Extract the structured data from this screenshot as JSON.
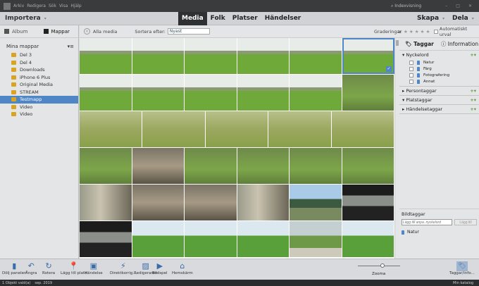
{
  "titlebar": {
    "menu": [
      "Arkiv",
      "Redigera",
      "Sök",
      "Visa",
      "Hjälp"
    ],
    "indexing": "Indexvisning"
  },
  "topbar": {
    "import": "Importera",
    "tabs": [
      "Media",
      "Folk",
      "Platser",
      "Händelser"
    ],
    "active_tab": "Media",
    "create": "Skapa",
    "share": "Dela"
  },
  "left": {
    "tabs": [
      "Album",
      "Mappar"
    ],
    "active_tab": "Mappar",
    "section": "Mina mappar",
    "folders": [
      "Del 3",
      "Del 4",
      "Downloads",
      "iPhone 6 Plus",
      "Original Media",
      "STREAM",
      "Testmapp",
      "Video",
      "Video"
    ],
    "selected": "Testmapp"
  },
  "crumb": {
    "back": "Alla media",
    "sort_label": "Sortera efter:",
    "sort_value": "Nyast",
    "ratings_label": "Graderingar",
    "ratings_op": "≥",
    "stars": "★ ★ ★ ★ ★",
    "auto_label": "Automatiskt urval"
  },
  "grid": {
    "rows": [
      [
        "h",
        "h",
        "h",
        "h",
        "h",
        "h"
      ],
      [
        "h",
        "h",
        "h",
        "h",
        "h",
        "f"
      ],
      [
        "d",
        "d",
        "d",
        "d",
        "d"
      ],
      [
        "f",
        "r",
        "f",
        "f",
        "f",
        "f"
      ],
      [
        "t",
        "r",
        "r",
        "t",
        "m",
        "c"
      ],
      [
        "c",
        "g",
        "g",
        "g",
        "p",
        "g"
      ]
    ],
    "selected": [
      0,
      5
    ]
  },
  "right": {
    "tabs": [
      "Taggar",
      "Information"
    ],
    "active_tab": "Taggar",
    "keywords_label": "Nyckelord",
    "keywords": [
      "Natur",
      "Färg",
      "Fotografering",
      "Annat"
    ],
    "sections": [
      "Persontaggar",
      "Platstaggar",
      "Händelsetaggar"
    ],
    "image_tags_label": "Bildtaggar",
    "input_placeholder": "Lägg till anpa. nyckelord",
    "add_button": "Lägg till",
    "image_tags": [
      "Natur"
    ]
  },
  "toolbar": [
    {
      "label": "Dölj panelen",
      "icon": "▮"
    },
    {
      "label": "Ångra",
      "icon": "↶"
    },
    {
      "label": "Rotera",
      "icon": "↻"
    },
    {
      "label": "Lägg till plats",
      "icon": "📍"
    },
    {
      "label": "Händelse",
      "icon": "▣"
    },
    {
      "label": "Direktkorrig...",
      "icon": "⚡"
    },
    {
      "label": "Redigeraren",
      "icon": "▨"
    },
    {
      "label": "Bildspel",
      "icon": "▶"
    },
    {
      "label": "Hemskärm",
      "icon": "⌂"
    }
  ],
  "zoom_label": "Zooma",
  "tags_info": "Taggar/info...",
  "status": {
    "selected": "1 Objekt vald(a)",
    "date": "sep. 2019",
    "catalog": "Min katalog"
  }
}
